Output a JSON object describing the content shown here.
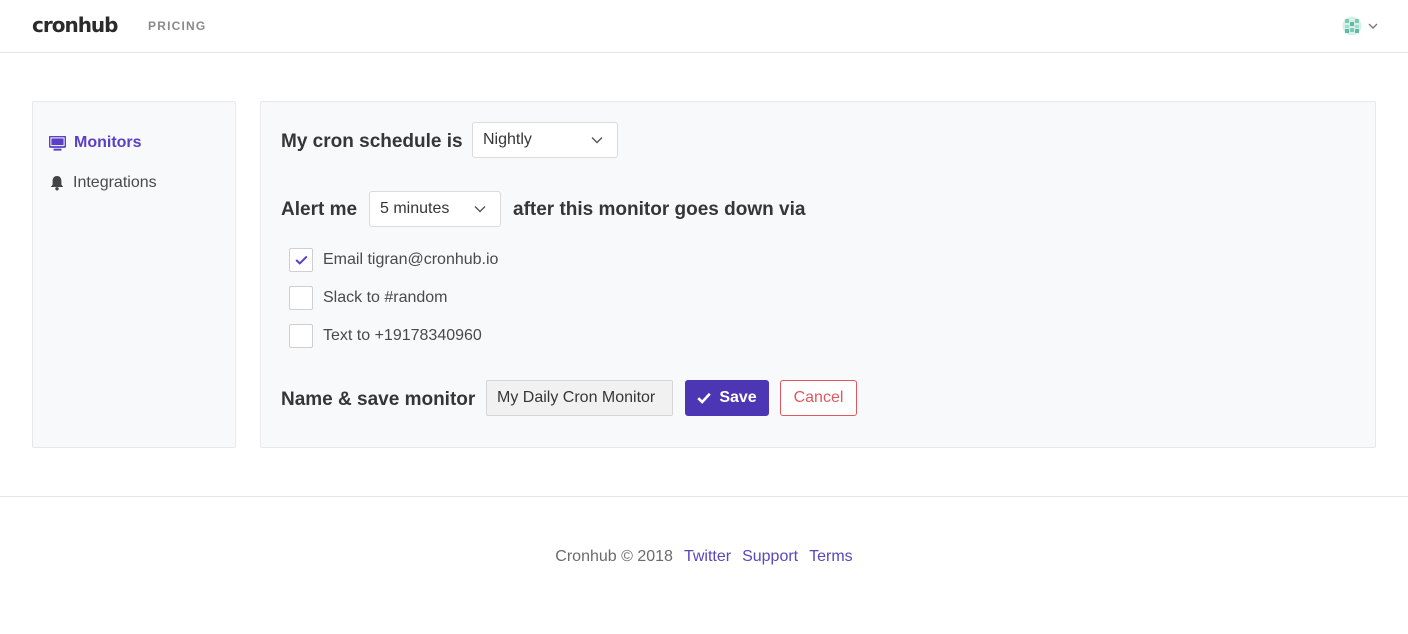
{
  "header": {
    "logo": "cronhub",
    "nav": [
      {
        "label": "PRICING"
      }
    ]
  },
  "sidebar": {
    "items": [
      {
        "label": "Monitors",
        "icon": "monitor-icon",
        "active": true
      },
      {
        "label": "Integrations",
        "icon": "bell-icon",
        "active": false
      }
    ]
  },
  "form": {
    "schedule_label": "My cron schedule is",
    "schedule_value": "Nightly",
    "alert_prefix": "Alert me",
    "alert_value": "5 minutes",
    "alert_suffix": "after this monitor goes down via",
    "channels": [
      {
        "label": "Email tigran@cronhub.io",
        "checked": true
      },
      {
        "label": "Slack to #random",
        "checked": false
      },
      {
        "label": "Text to +19178340960",
        "checked": false
      }
    ],
    "name_label": "Name & save monitor",
    "name_value": "My Daily Cron Monitor",
    "save_label": "Save",
    "cancel_label": "Cancel"
  },
  "footer": {
    "copyright": "Cronhub © 2018",
    "links": [
      "Twitter",
      "Support",
      "Terms"
    ]
  },
  "colors": {
    "accent": "#5b3fc4",
    "save_button": "#4d36b3",
    "cancel": "#e0585f",
    "card_bg": "#f8f9fb"
  }
}
